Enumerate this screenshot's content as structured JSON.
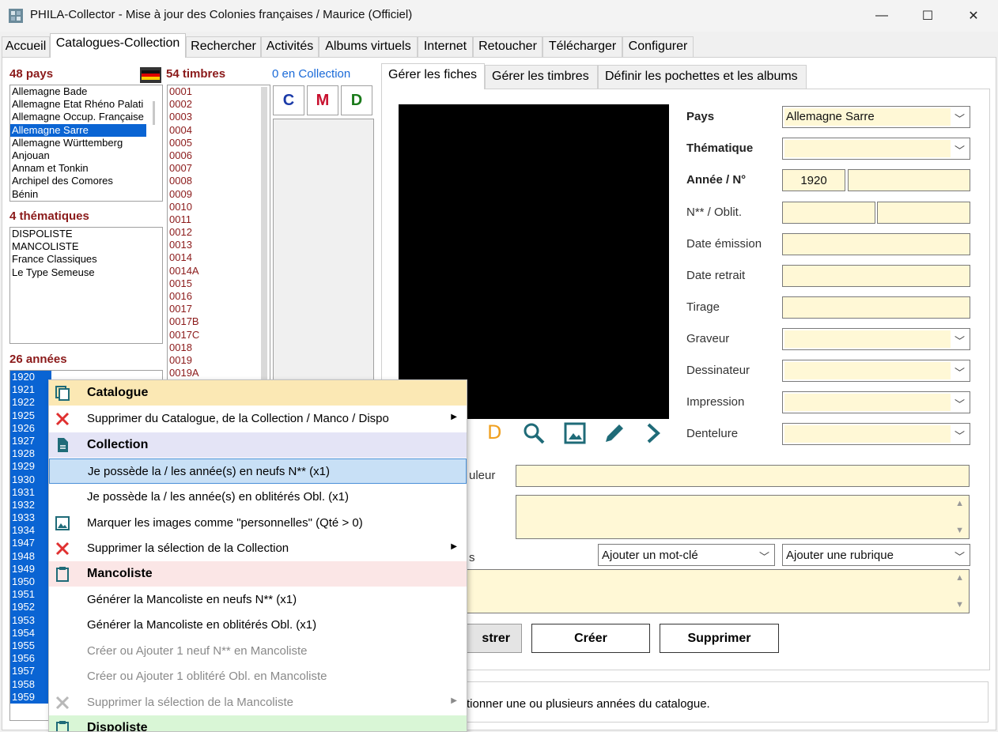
{
  "window": {
    "title": "PHILA-Collector - Mise à jour des Colonies françaises / Maurice (Officiel)",
    "minimize": "—",
    "maximize": "☐",
    "close": "✕"
  },
  "menu_tabs": [
    "Accueil",
    "Catalogues-Collection",
    "Rechercher",
    "Activités",
    "Albums virtuels",
    "Internet",
    "Retoucher",
    "Télécharger",
    "Configurer"
  ],
  "countries": {
    "header": "48 pays",
    "items": [
      "Allemagne Bade",
      "Allemagne Etat Rhéno Palati",
      "Allemagne Occup. Française",
      "Allemagne Sarre",
      "Allemagne Württemberg",
      "Anjouan",
      "Annam et Tonkin",
      "Archipel des Comores",
      "Bénin"
    ],
    "selected": "Allemagne Sarre"
  },
  "thematics": {
    "header": "4 thématiques",
    "items": [
      "DISPOLISTE",
      "MANCOLISTE",
      "France Classiques",
      "Le Type Semeuse"
    ]
  },
  "years": {
    "header": "26 années",
    "items": [
      "1920",
      "1921",
      "1922",
      "1925",
      "1926",
      "1927",
      "1928",
      "1929",
      "1930",
      "1931",
      "1932",
      "1933",
      "1934",
      "1947",
      "1948",
      "1949",
      "1950",
      "1951",
      "1952",
      "1953",
      "1954",
      "1955",
      "1956",
      "1957",
      "1958",
      "1959"
    ]
  },
  "stamps": {
    "header": "54 timbres",
    "items": [
      "0001",
      "0002",
      "0003",
      "0004",
      "0005",
      "0006",
      "0007",
      "0008",
      "0009",
      "0010",
      "0011",
      "0012",
      "0013",
      "0014",
      "0014A",
      "0015",
      "0016",
      "0017",
      "0017B",
      "0017C",
      "0018",
      "0019",
      "0019A"
    ]
  },
  "collection": {
    "header": "0 en Collection",
    "buttons": [
      "C",
      "M",
      "D"
    ],
    "colors": {
      "C": "#1a3aa8",
      "M": "#c8102e",
      "D": "#1a7a1a"
    }
  },
  "right_tabs": [
    "Gérer les fiches",
    "Gérer les timbres",
    "Définir les pochettes et les albums"
  ],
  "form": {
    "pays_label": "Pays",
    "pays_value": "Allemagne Sarre",
    "thematique_label": "Thématique",
    "annee_label": "Année / N°",
    "annee_value": "1920",
    "nobli_label": "N** / Oblit.",
    "date_emission_label": "Date émission",
    "date_retrait_label": "Date retrait",
    "tirage_label": "Tirage",
    "graveur_label": "Graveur",
    "dessinateur_label": "Dessinateur",
    "impression_label": "Impression",
    "dentelure_label": "Dentelure",
    "couleur_label_partial": "uleur",
    "mots_label_partial": "s",
    "keyword_placeholder": "Ajouter un mot-clé",
    "rubrique_placeholder": "Ajouter une rubrique"
  },
  "toolbar_icons": {
    "d_label": "D"
  },
  "buttons": {
    "enregistrer_partial": "strer",
    "creer": "Créer",
    "supprimer": "Supprimer"
  },
  "status_partial": "tionner une ou plusieurs années du catalogue.",
  "context_menu": {
    "items": [
      {
        "label": "Catalogue",
        "type": "section",
        "bg": "#fbe8b4",
        "icon": "copy-icon"
      },
      {
        "label": "Supprimer du Catalogue, de la Collection / Manco / Dispo",
        "type": "item",
        "icon": "red-x-icon",
        "submenu": true
      },
      {
        "label": "Collection",
        "type": "section",
        "bg": "#e4e4f6",
        "icon": "document-icon"
      },
      {
        "label": "Je possède la / les année(s) en neufs N** (x1)",
        "type": "item",
        "hover": true
      },
      {
        "label": "Je possède la / les année(s) en oblitérés Obl. (x1)",
        "type": "item"
      },
      {
        "label": "Marquer les images comme \"personnelles\" (Qté > 0)",
        "type": "item",
        "icon": "image-icon"
      },
      {
        "label": "Supprimer la sélection de la Collection",
        "type": "item",
        "icon": "red-x-icon",
        "submenu": true
      },
      {
        "label": "Mancoliste",
        "type": "section",
        "bg": "#fbe6e6",
        "icon": "clipboard-icon"
      },
      {
        "label": "Générer la Mancoliste en neufs N** (x1)",
        "type": "item"
      },
      {
        "label": "Générer la Mancoliste en oblitérés Obl. (x1)",
        "type": "item"
      },
      {
        "label": "Créer ou Ajouter 1 neuf N** en Mancoliste",
        "type": "disabled"
      },
      {
        "label": "Créer ou Ajouter 1 oblitéré Obl. en Mancoliste",
        "type": "disabled"
      },
      {
        "label": "Supprimer la sélection de la Mancoliste",
        "type": "disabled",
        "icon": "gray-x-icon",
        "submenu": true
      },
      {
        "label": "Dispoliste",
        "type": "section",
        "bg": "#d9f6d6",
        "icon": "clipboard-icon"
      }
    ]
  }
}
